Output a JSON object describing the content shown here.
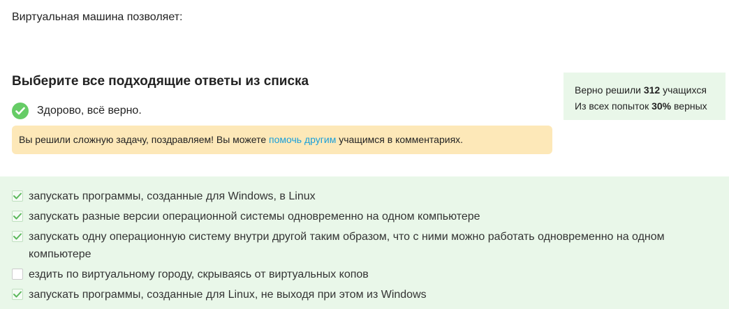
{
  "question": {
    "text": "Виртуальная машина позволяет:"
  },
  "task": {
    "heading": "Выберите все подходящие ответы из списка",
    "result_text": "Здорово, всё верно."
  },
  "notice": {
    "before_link": "Вы решили сложную задачу, поздравляем! Вы можете ",
    "link_text": "помочь другим",
    "after_link": " учащимся в комментариях."
  },
  "stats": {
    "solved_prefix": "Верно решили ",
    "solved_count": "312",
    "solved_suffix": " учащихся",
    "attempts_prefix": "Из всех попыток ",
    "attempts_percent": "30%",
    "attempts_suffix": " верных"
  },
  "options": [
    {
      "label": "запускать программы, созданные для Windows, в Linux",
      "checked": true
    },
    {
      "label": "запускать разные версии операционной системы одновременно на одном компьютере",
      "checked": true
    },
    {
      "label": "запускать одну операционную систему внутри другой таким образом, что с ними можно работать одновременно на одном компьютере",
      "checked": true
    },
    {
      "label": "ездить по виртуальному городу, скрываясь от виртуальных копов",
      "checked": false
    },
    {
      "label": "запускать программы, созданные для Linux, не выходя при этом из Windows",
      "checked": true
    }
  ],
  "colors": {
    "success_green": "#66cc66",
    "notice_bg": "#fde8b8",
    "stats_bg": "#e9f7e9",
    "link_blue": "#1a9fd9"
  },
  "icons": {
    "result": "check-circle-icon",
    "option_checked": "checkmark-icon"
  }
}
